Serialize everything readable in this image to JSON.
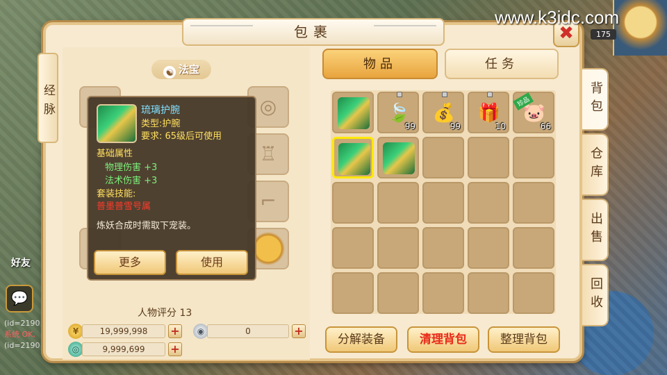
{
  "watermark": "www.k3idc.com",
  "top_right": {
    "level": "175"
  },
  "background": {
    "friend_label": "好友",
    "chat_lines": [
      {
        "text": "(id=2190",
        "system": false
      },
      {
        "text": "系统 OK,",
        "system": true
      },
      {
        "text": "(id=2190",
        "system": false
      }
    ]
  },
  "window": {
    "title": "包裹",
    "close_icon": "✖"
  },
  "left_tab": "经脉",
  "fabao": {
    "title": "法宝",
    "yin_symbol": "☯"
  },
  "rating": {
    "label": "人物评分",
    "value": "13",
    "text": "人物评分 13"
  },
  "currency": {
    "gold": "19,999,998",
    "silver": "0",
    "jade": "9,999,699",
    "plus": "+"
  },
  "tooltip": {
    "name": "琉璃护腕",
    "type": "类型:护腕",
    "requirement": "要求: 65级后可使用",
    "base_attr_title": "基础属性",
    "attr1": "物理伤害 +3",
    "attr2": "法术伤害 +3",
    "set_skill_title": "套装技能:",
    "set_skill_value": "普墨普雪号属",
    "note": "炼妖合成时需取下宠装。",
    "more_button": "更多",
    "use_button": "使用"
  },
  "tabs": {
    "items": "物品",
    "tasks": "任务"
  },
  "side_tabs": [
    "背包",
    "仓库",
    "出售",
    "回收"
  ],
  "inventory": [
    {
      "kind": "bracer",
      "icon": "",
      "count": "",
      "lock": false,
      "ribbon": ""
    },
    {
      "kind": "herb",
      "icon": "🍃",
      "count": "99",
      "lock": true,
      "ribbon": ""
    },
    {
      "kind": "bag",
      "icon": "💰",
      "count": "99",
      "lock": true,
      "ribbon": ""
    },
    {
      "kind": "gift",
      "icon": "🎁",
      "count": "10",
      "lock": true,
      "ribbon": ""
    },
    {
      "kind": "pet",
      "icon": "🐷",
      "count": "66",
      "lock": false,
      "ribbon": "珍品"
    },
    {
      "kind": "bracer",
      "icon": "",
      "count": "",
      "lock": false,
      "ribbon": "",
      "selected": true
    },
    {
      "kind": "bracer",
      "icon": "",
      "count": "",
      "lock": false,
      "ribbon": ""
    }
  ],
  "buttons": {
    "decompose": "分解装备",
    "clear": "清理背包",
    "sort": "整理背包"
  }
}
